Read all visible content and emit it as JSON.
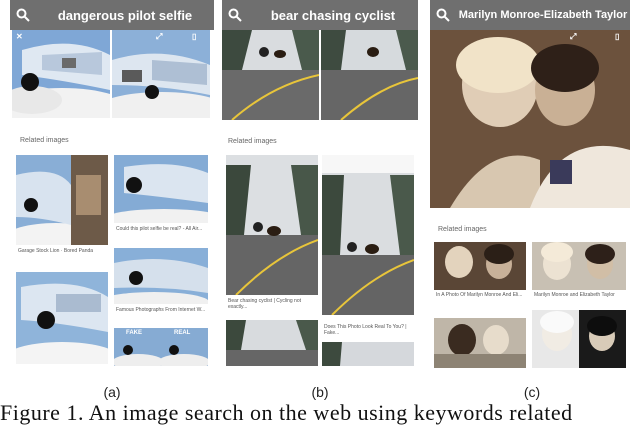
{
  "panels": [
    {
      "query": "dangerous pilot selfie",
      "related_label": "Related images",
      "captions": [
        "Garage Stock Lion · Bored Panda",
        "Could this pilot selfie be real? - All Air...",
        "Famous Photographs From Internet W...",
        ""
      ],
      "thumb_text": [
        "FAKE",
        "REAL"
      ]
    },
    {
      "query": "bear chasing cyclist",
      "related_label": "Related images",
      "captions": [
        "Bear chasing cyclist | Cycling not exactly...",
        "Does This Photo Look Real To You? | Fake..."
      ]
    },
    {
      "query": "Marilyn Monroe-Elizabeth Taylor",
      "related_label": "Related images",
      "captions": [
        "In A Photo Of Marilyn Monroe And Eli...",
        "Marilyn Monroe and Elizabeth Taylor"
      ]
    }
  ],
  "sublabels": [
    "(a)",
    "(b)",
    "(c)"
  ],
  "figure_caption": "Figure 1. An image search on the web using keywords related",
  "colors": {
    "searchbar": "#6f6f6f",
    "sky": "#8fb3d9",
    "road": "#4a4a4a",
    "sepia": "#6b4f3a"
  },
  "icons": [
    "search-icon",
    "close-icon",
    "share-icon",
    "bookmark-icon"
  ]
}
